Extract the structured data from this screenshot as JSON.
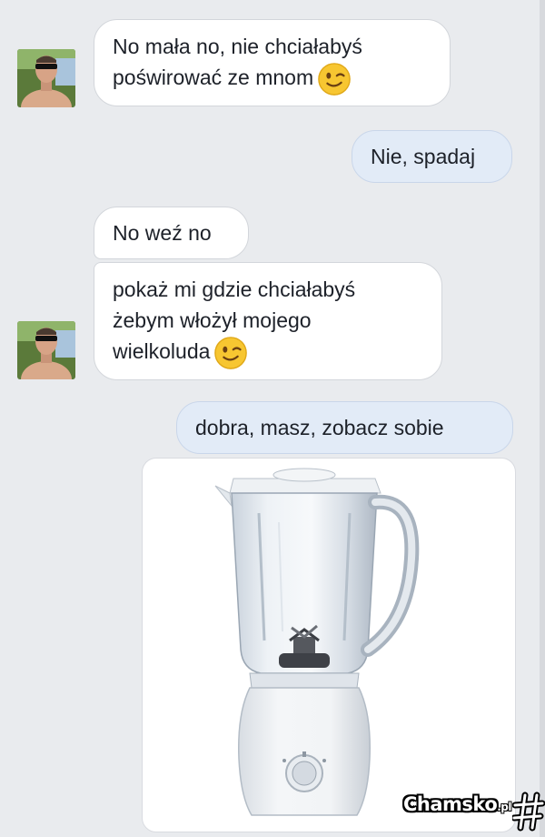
{
  "messages": [
    {
      "sender": "them",
      "text": "No mała no, nie chciałabyś",
      "text2": "poświrować ze mnom",
      "emoji": "winking-face"
    },
    {
      "sender": "me",
      "text": "Nie, spadaj"
    },
    {
      "sender": "them",
      "text": "No weź no"
    },
    {
      "sender": "them",
      "text": "pokaż mi gdzie chciałabyś",
      "text2": "żebym włożył mojego",
      "text3": "wielkoluda",
      "emoji": "winking-face"
    },
    {
      "sender": "me",
      "text": "dobra, masz, zobacz sobie"
    },
    {
      "sender": "me",
      "type": "image",
      "image_subject": "blender-image"
    }
  ],
  "watermark": {
    "brand": "Chamsko",
    "tld": ".pl"
  },
  "colors": {
    "incoming_bubble": "#ffffff",
    "outgoing_bubble": "#e2ebf7",
    "background": "#e9ebee",
    "text": "#1d2129"
  }
}
